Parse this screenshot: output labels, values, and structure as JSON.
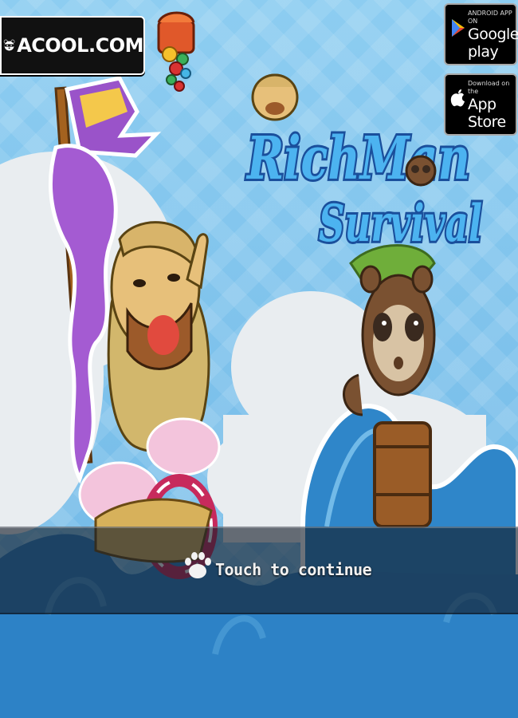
{
  "brand": {
    "name": "ACOOL.COM"
  },
  "stores": {
    "google_play": {
      "top_text": "ANDROID APP ON",
      "name": "Google play"
    },
    "app_store": {
      "top_text": "Download on the",
      "name": "App Store"
    }
  },
  "game": {
    "title_line1": "RichMan",
    "title_line2": "Survival"
  },
  "prompt": {
    "label": "Touch to continue"
  },
  "colors": {
    "sky": "#7ec3ec",
    "wave": "#2f86c9",
    "title_fill": "#4cb3f0",
    "title_outline": "#1a4f9c"
  }
}
